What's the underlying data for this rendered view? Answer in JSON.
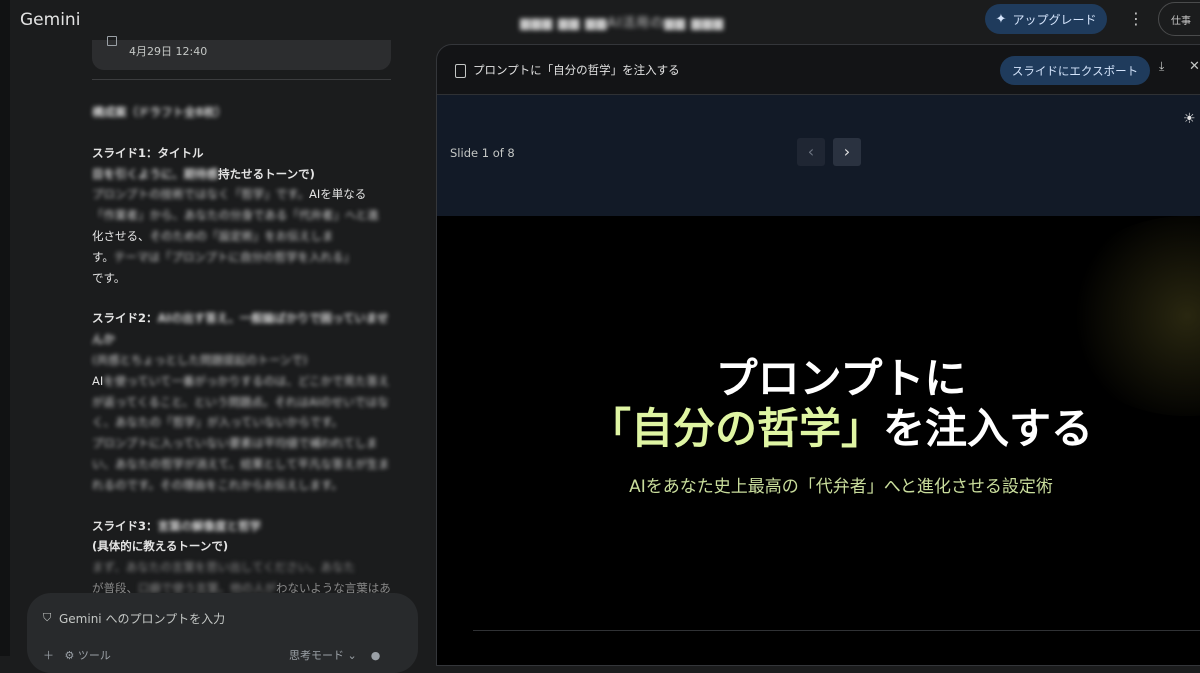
{
  "app": {
    "name": "Gemini",
    "conversation_title": "▆▆▆ ▆▆ ▆▆AI活用の▆▆ ▆▆▆"
  },
  "header": {
    "upgrade_label": "アップグレード",
    "workspace_label": "仕事"
  },
  "chat": {
    "timestamp": "4月29日 12:40",
    "heading_blurred": "構成案（ドラフト全8枚）",
    "slides": [
      {
        "label": "スライド1：タイトル",
        "tone_prefix_blurred": "目を引くように、期待感",
        "tone_suffix": "持たせるトーンで)",
        "lines": [
          {
            "blurred": "プロンプトの技術ではなく「哲学」です。",
            "text": "AIを単なる"
          },
          {
            "blurred": "「作業者」から、あなたの分身である「代弁者」へと進"
          },
          {
            "text": "化させる、",
            "blurred": "そのための「設定術」をお伝えしま"
          },
          {
            "text": "す。",
            "blurred": "テーマは「プロンプトに自分の哲学を入れる」"
          },
          {
            "text": "です。"
          }
        ]
      },
      {
        "label_prefix": "スライド2：",
        "label_blurred": "AIの出す答え、一般論ばかりで困っていませんか",
        "lines": [
          {
            "blurred": "(共感とちょっとした問題提起のトーンで)"
          },
          {
            "text": "AI",
            "blurred": "を使っていて一番がっかりするのは、どこかで見た答え"
          },
          {
            "blurred": "が返ってくること、という問題点。それはAIのせいではな"
          },
          {
            "blurred": "く、あなたの「哲学」が入っていないからです。"
          },
          {
            "blurred": "プロンプトに入っていない要素は平均値で補われてしま"
          },
          {
            "blurred": "い、あなたの哲学が消えて、結果として平凡な答えが生ま"
          },
          {
            "blurred": "れるのです。その理由をこれからお伝えします。"
          }
        ]
      },
      {
        "label_prefix": "スライド3：",
        "label_blurred": "言葉の解像度と哲学",
        "tone": "(具体的に教えるトーンで)",
        "lines": [
          {
            "blurred": "まず、あなたの言葉を思い出してください。あなた"
          },
          {
            "text": "が普段、",
            "blurred": "口癖で使う言葉、他の人が",
            "text2": "わないような言葉はありませ"
          }
        ]
      }
    ]
  },
  "prompt": {
    "placeholder": "Gemini へのプロンプトを入力",
    "tools_label": "ツール",
    "mode_label": "思考モード"
  },
  "canvas": {
    "title": "プロンプトに「自分の哲学」を注入する",
    "export_label": "スライドにエクスポート",
    "counter": "Slide 1 of 8",
    "slide": {
      "title_line1": "プロンプトに",
      "title_accent": "「自分の哲学」",
      "title_rest": "を注入する",
      "subtitle": "AIをあなた史上最高の「代弁者」へと進化させる設定術"
    }
  },
  "colors": {
    "background": "#1b1c1d",
    "accent_button": "#1f3b5c",
    "slide_accent": "#dff5a3",
    "slide_subtitle": "#c9dd9c"
  },
  "icons": [
    "sparkle-icon",
    "more-vert-icon",
    "calendar-icon",
    "shield-icon",
    "add-icon",
    "tools-icon",
    "chevron-down-icon",
    "mic-icon",
    "document-icon",
    "download-icon",
    "close-icon",
    "theme-sun-icon",
    "chevron-left-icon",
    "chevron-right-icon"
  ]
}
